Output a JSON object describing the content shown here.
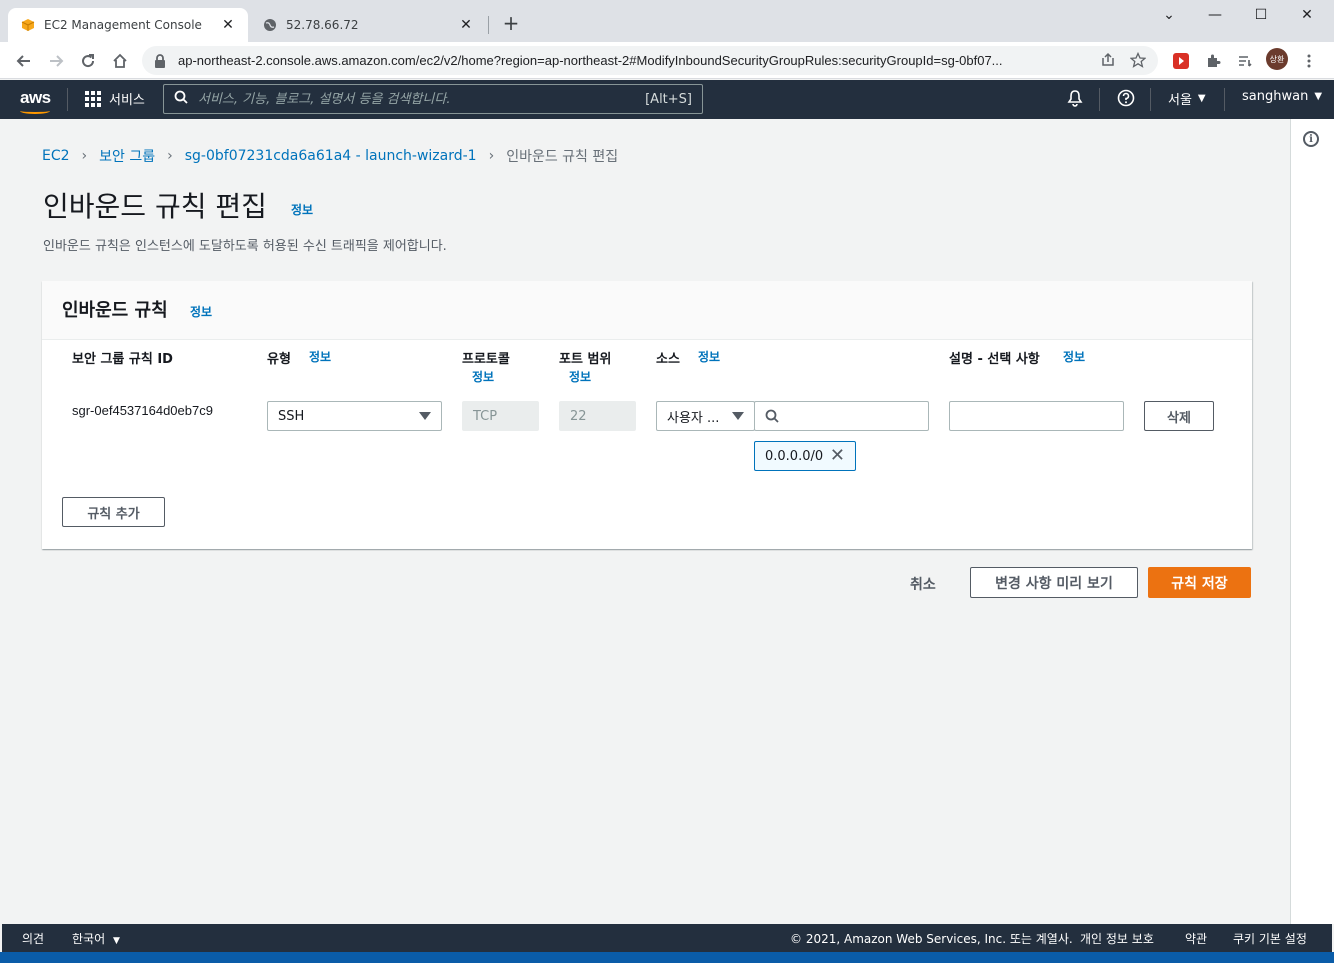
{
  "browser": {
    "tabs": [
      {
        "title": "EC2 Management Console",
        "icon": "aws-cube-icon"
      },
      {
        "title": "52.78.66.72",
        "icon": "globe-icon"
      }
    ],
    "url": "ap-northeast-2.console.aws.amazon.com/ec2/v2/home?region=ap-northeast-2#ModifyInboundSecurityGroupRules:securityGroupId=sg-0bf07...",
    "profile_initials": "상환"
  },
  "aws_header": {
    "logo": "aws",
    "services_label": "서비스",
    "search_placeholder": "서비스, 기능, 블로그, 설명서 등을 검색합니다.",
    "search_shortcut": "[Alt+S]",
    "region": "서울",
    "user": "sanghwan"
  },
  "breadcrumb": {
    "items": [
      "EC2",
      "보안 그룹",
      "sg-0bf07231cda6a61a4 - launch-wizard-1"
    ],
    "current": "인바운드 규칙 편집"
  },
  "page": {
    "title": "인바운드 규칙 편집",
    "info": "정보",
    "description": "인바운드 규칙은 인스턴스에 도달하도록 허용된 수신 트래픽을 제어합니다."
  },
  "rules_card": {
    "title": "인바운드 규칙",
    "info": "정보",
    "columns": {
      "id": "보안 그룹 규칙 ID",
      "type": "유형",
      "protocol": "프로토콜",
      "port": "포트 범위",
      "source": "소스",
      "description": "설명 - 선택 사항"
    },
    "row": {
      "id": "sgr-0ef4537164d0eb7c9",
      "type": "SSH",
      "protocol": "TCP",
      "port": "22",
      "source_type": "사용자 ...",
      "source_search": "",
      "cidr_token": "0.0.0.0/0",
      "description": "",
      "delete_label": "삭제"
    },
    "add_rule_label": "규칙 추가"
  },
  "actions": {
    "cancel": "취소",
    "preview": "변경 사항 미리 보기",
    "save": "규칙 저장"
  },
  "footer": {
    "feedback": "의견",
    "language": "한국어",
    "copyright": "© 2021, Amazon Web Services, Inc. 또는 계열사.",
    "privacy": "개인 정보 보호",
    "terms": "약관",
    "cookies": "쿠키 기본 설정"
  },
  "colors": {
    "aws_nav": "#232f3e",
    "link": "#0073bb",
    "primary": "#ec7211"
  }
}
